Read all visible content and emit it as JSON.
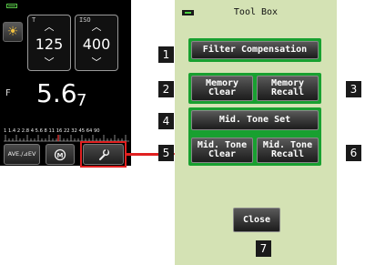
{
  "meter": {
    "t_label": "T",
    "t_value": "125",
    "iso_label": "ISO",
    "iso_value": "400",
    "f_label": "F",
    "f_value": "5.6",
    "f_tenth": "7",
    "scale_labels": "1  1.4  2  2.8  4  5.6  8  11  16  22  32  45  64  90",
    "ave_label": "AVE./⊿EV",
    "memory_glyph": "M",
    "colors": {
      "highlight": "#e02020",
      "background": "#000000"
    }
  },
  "toolbox": {
    "title": "Tool Box",
    "filter_compensation": "Filter Compensation",
    "memory_clear": [
      "Memory",
      "Clear"
    ],
    "memory_recall": [
      "Memory",
      "Recall"
    ],
    "mid_tone_set": "Mid. Tone Set",
    "mid_tone_clear": [
      "Mid. Tone",
      "Clear"
    ],
    "mid_tone_recall": [
      "Mid. Tone",
      "Recall"
    ],
    "close": "Close",
    "colors": {
      "panel": "#d4e2b4",
      "group": "#18a030",
      "button": "#3a3a3a"
    }
  },
  "callouts": [
    "1",
    "2",
    "3",
    "4",
    "5",
    "6",
    "7"
  ]
}
